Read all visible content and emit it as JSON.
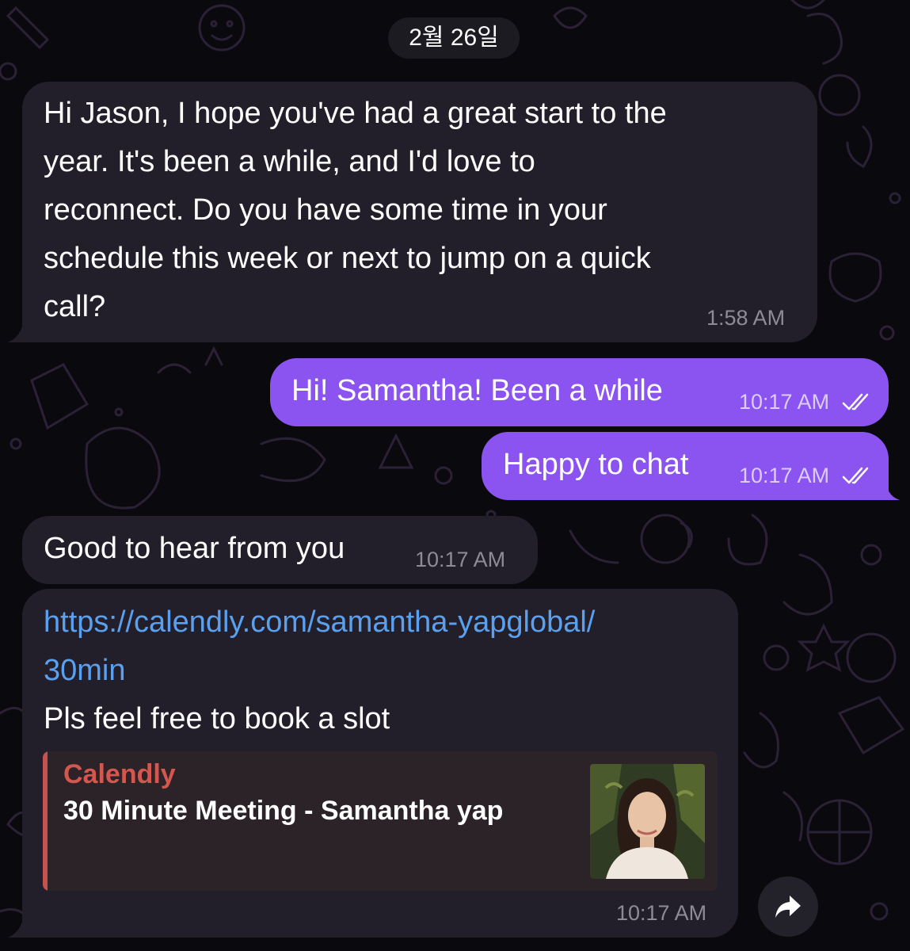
{
  "date_separator": "2월 26일",
  "messages": [
    {
      "direction": "incoming",
      "lines": [
        "Hi Jason, I hope you've had a great start to the",
        "year. It's been a while, and I'd love to",
        "reconnect. Do you have some time in your",
        "schedule this week or next to jump on a quick",
        "call?"
      ],
      "time": "1:58 AM"
    },
    {
      "direction": "outgoing",
      "text": "Hi! Samantha! Been a while",
      "time": "10:17 AM",
      "status": "read"
    },
    {
      "direction": "outgoing",
      "text": "Happy to chat",
      "time": "10:17 AM",
      "status": "read"
    },
    {
      "direction": "incoming",
      "text": "Good to hear from you",
      "time": "10:17 AM"
    },
    {
      "direction": "incoming",
      "link_lines": [
        "https://calendly.com/samantha-yapglobal/",
        "30min"
      ],
      "text": "Pls feel free to book a slot",
      "time": "10:17 AM",
      "link_preview": {
        "site_name": "Calendly",
        "title": "30 Minute Meeting - Samantha yap",
        "thumbnail_icon": "profile-photo"
      }
    }
  ],
  "share_button_icon": "share-arrow-icon",
  "colors": {
    "background": "#0a090d",
    "incoming_bubble": "#221f2a",
    "outgoing_bubble": "#8b54f0",
    "link": "#5aa0ee",
    "preview_accent": "#c4524f"
  }
}
